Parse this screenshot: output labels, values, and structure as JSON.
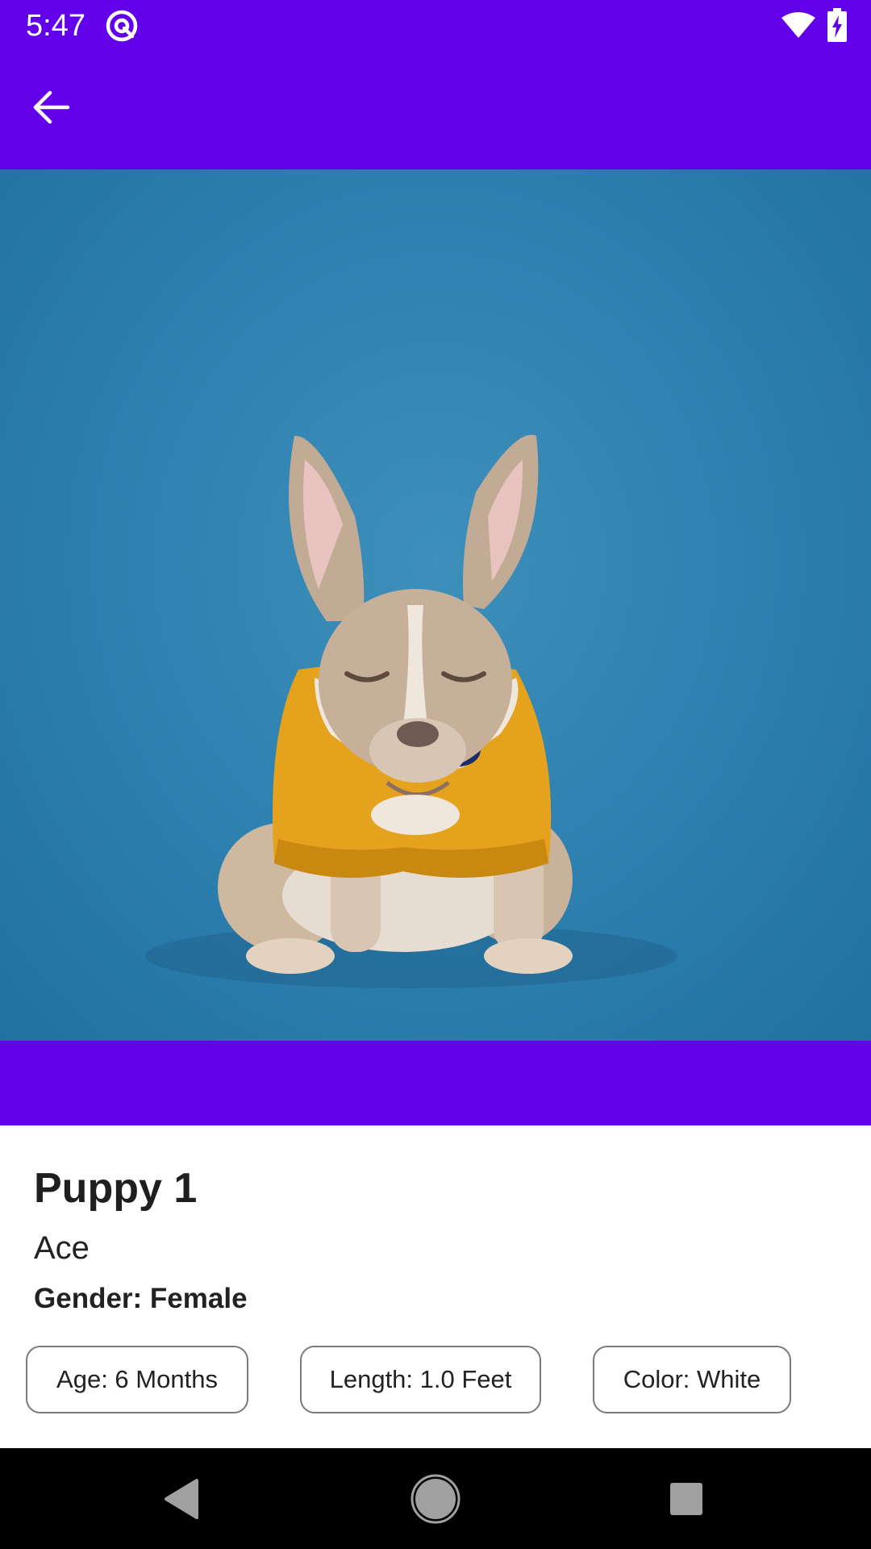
{
  "status_bar": {
    "time": "5:47",
    "app_icon": "at-sign-icon",
    "wifi_icon": "wifi-icon",
    "battery_icon": "battery-charging-icon"
  },
  "app_bar": {
    "back_icon": "arrow-left-icon",
    "background_color": "#6200ea"
  },
  "hero": {
    "image_subject": "dog-photo"
  },
  "puppy": {
    "title": "Puppy 1",
    "name": "Ace",
    "gender": "Gender: Female",
    "chips": {
      "age": "Age: 6 Months",
      "length": "Length: 1.0 Feet",
      "color": "Color: White"
    }
  },
  "nav_bar": {
    "back_icon": "triangle-back-icon",
    "home_icon": "circle-home-icon",
    "recents_icon": "square-recents-icon"
  }
}
